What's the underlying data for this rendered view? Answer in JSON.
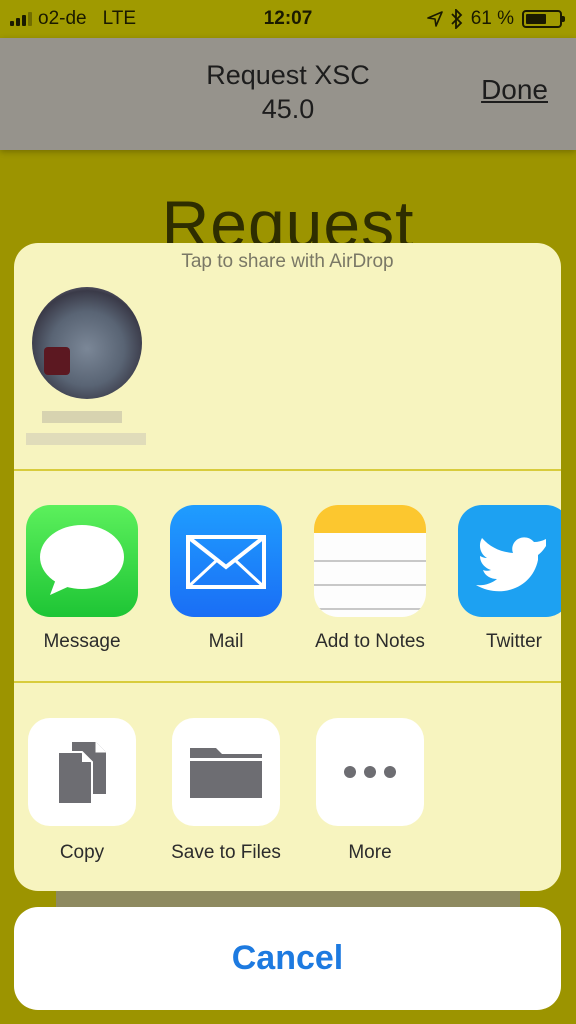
{
  "status_bar": {
    "carrier": "o2-de",
    "network": "LTE",
    "time": "12:07",
    "battery": "61 %",
    "battery_level": 0.61
  },
  "nav": {
    "title_line1": "Request XSC",
    "title_line2": "45.0",
    "done_label": "Done"
  },
  "background": {
    "heading": "Request"
  },
  "share_sheet": {
    "airdrop_hint": "Tap to share with AirDrop",
    "apps": [
      {
        "label": "Message",
        "icon": "message-icon"
      },
      {
        "label": "Mail",
        "icon": "mail-icon"
      },
      {
        "label": "Add to Notes",
        "icon": "notes-icon"
      },
      {
        "label": "Twitter",
        "icon": "twitter-icon"
      }
    ],
    "actions": [
      {
        "label": "Copy",
        "icon": "copy-icon"
      },
      {
        "label": "Save to Files",
        "icon": "folder-icon"
      },
      {
        "label": "More",
        "icon": "more-icon"
      }
    ],
    "cancel_label": "Cancel"
  },
  "colors": {
    "app_background": "#9c9400",
    "sheet_background": "#f7f4bf",
    "cancel_text": "#1d7ae0"
  }
}
